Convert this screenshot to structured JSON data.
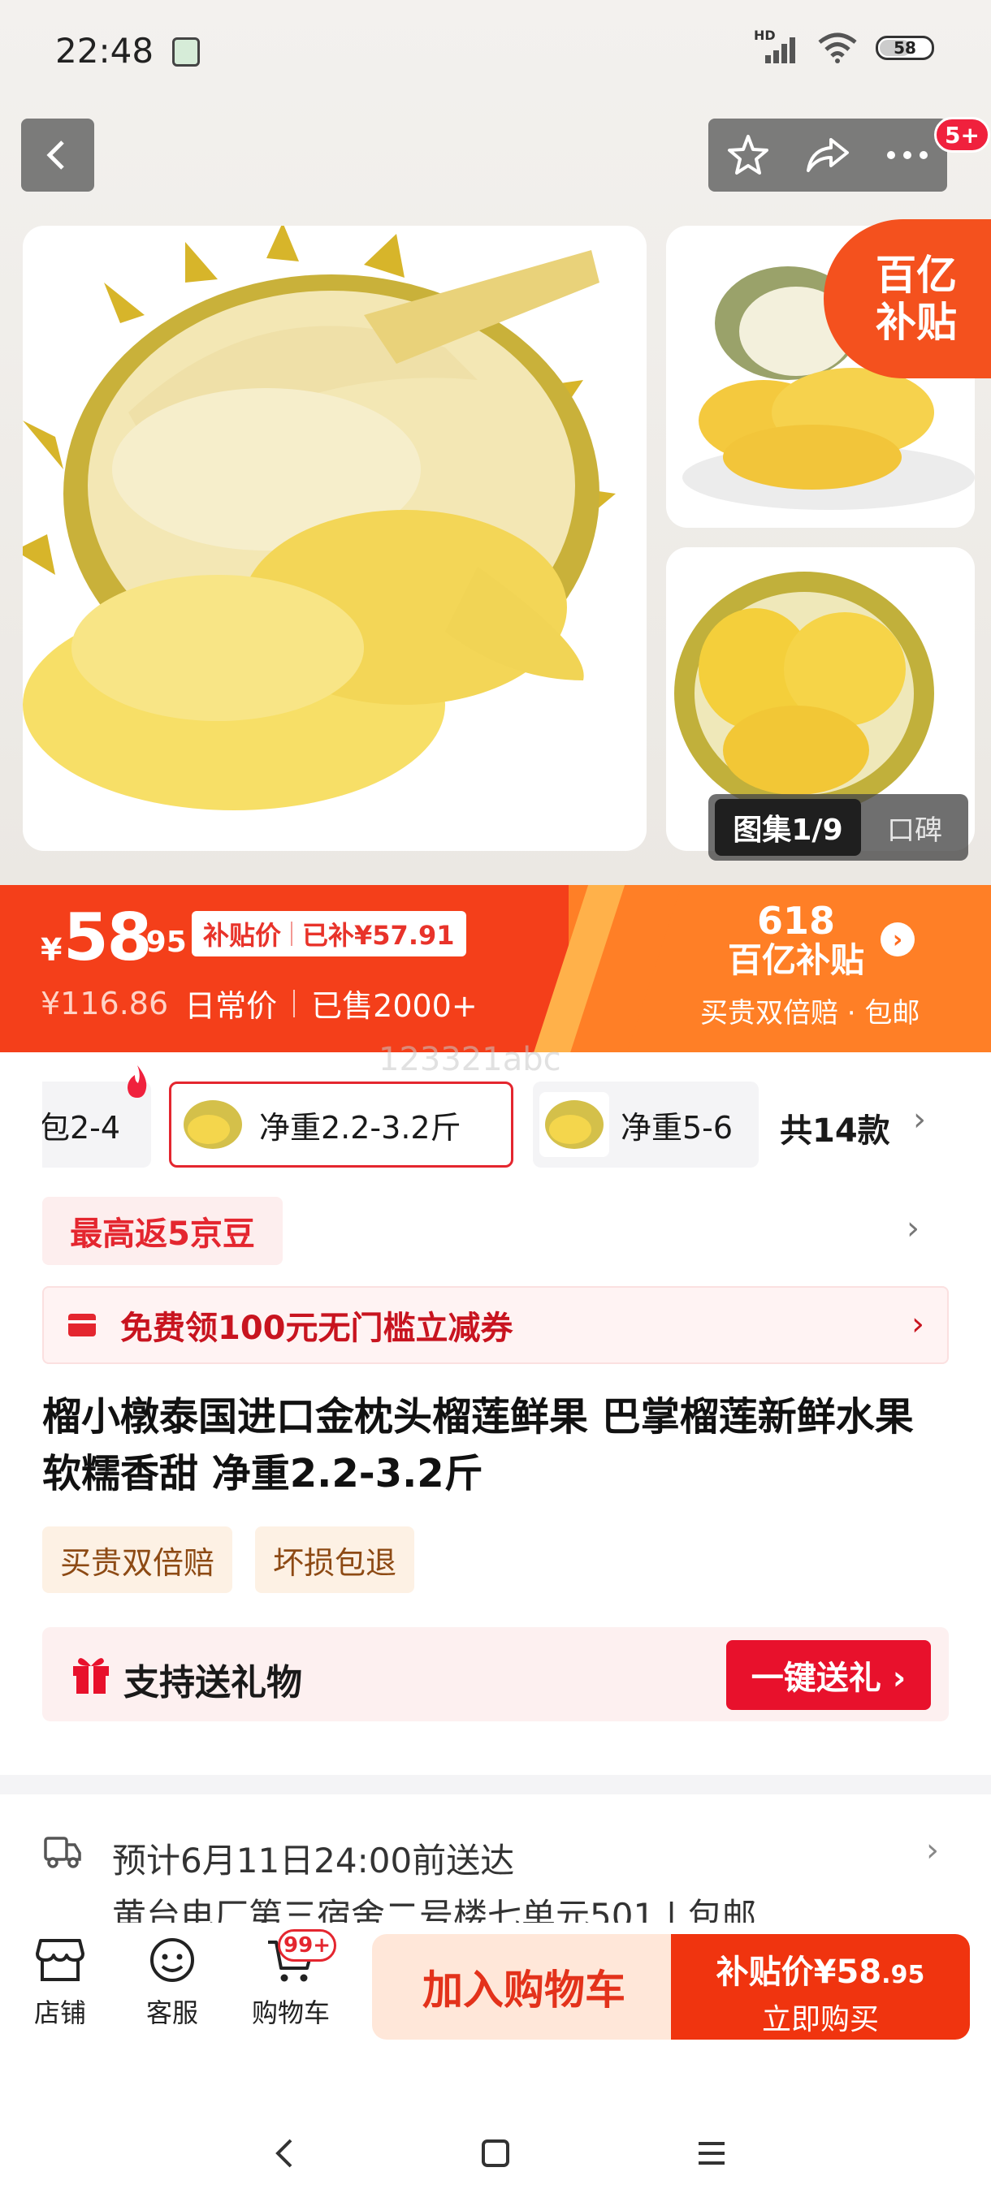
{
  "status_bar": {
    "time": "22:48",
    "network": "HD",
    "battery": "58"
  },
  "nav": {
    "cart_badge": "5+"
  },
  "gallery": {
    "subsidy_tag_line1": "百亿",
    "subsidy_tag_line2": "补贴",
    "album_label": "图集1/9",
    "reviews_label": "口碑"
  },
  "price": {
    "currency": "¥",
    "integer": "58",
    "decimal": ".95",
    "subsidy_label": "补贴价",
    "subsidy_amount": "已补¥57.91",
    "original_price": "¥116.86",
    "original_label": "日常价",
    "sold": "已售2000+",
    "promo_618": "618",
    "promo_title": "百亿补贴",
    "promo_sub": "买贵双倍赔 · 包邮",
    "watermark": "123321abc"
  },
  "variants": {
    "items": [
      {
        "label": "包2-4"
      },
      {
        "label": "净重2.2-3.2斤"
      },
      {
        "label": "净重5-6"
      }
    ],
    "total": "共14款"
  },
  "promos": {
    "rebate": "最高返5京豆",
    "coupon": "免费领100元无门槛立减券"
  },
  "product": {
    "title": "榴小橔泰国进口金枕头榴莲鲜果 巴掌榴莲新鲜水果 软糯香甜 净重2.2-3.2斤",
    "tags": [
      "买贵双倍赔",
      "坏损包退"
    ]
  },
  "gift": {
    "label": "支持送礼物",
    "button": "一键送礼 ›"
  },
  "delivery": {
    "eta": "预计6月11日24:00前送达",
    "address": "黄台电厂第三宿舍二号楼七单元501 | 包邮"
  },
  "bottom_bar": {
    "shop": "店铺",
    "service": "客服",
    "cart": "购物车",
    "cart_count": "99+",
    "add_to_cart": "加入购物车",
    "buy_price_label": "补贴价¥58",
    "buy_price_decimal": ".95",
    "buy_now": "立即购买"
  },
  "colors": {
    "accent": "#f43f1a",
    "brand_red": "#e4262f",
    "promo_orange": "#ff7f26"
  },
  "icons": [
    "back-icon",
    "star-icon",
    "share-icon",
    "more-icon",
    "fire-icon",
    "coupon-icon",
    "gift-icon",
    "delivery-icon",
    "shop-icon",
    "service-icon",
    "cart-icon",
    "chevron-right-icon"
  ]
}
